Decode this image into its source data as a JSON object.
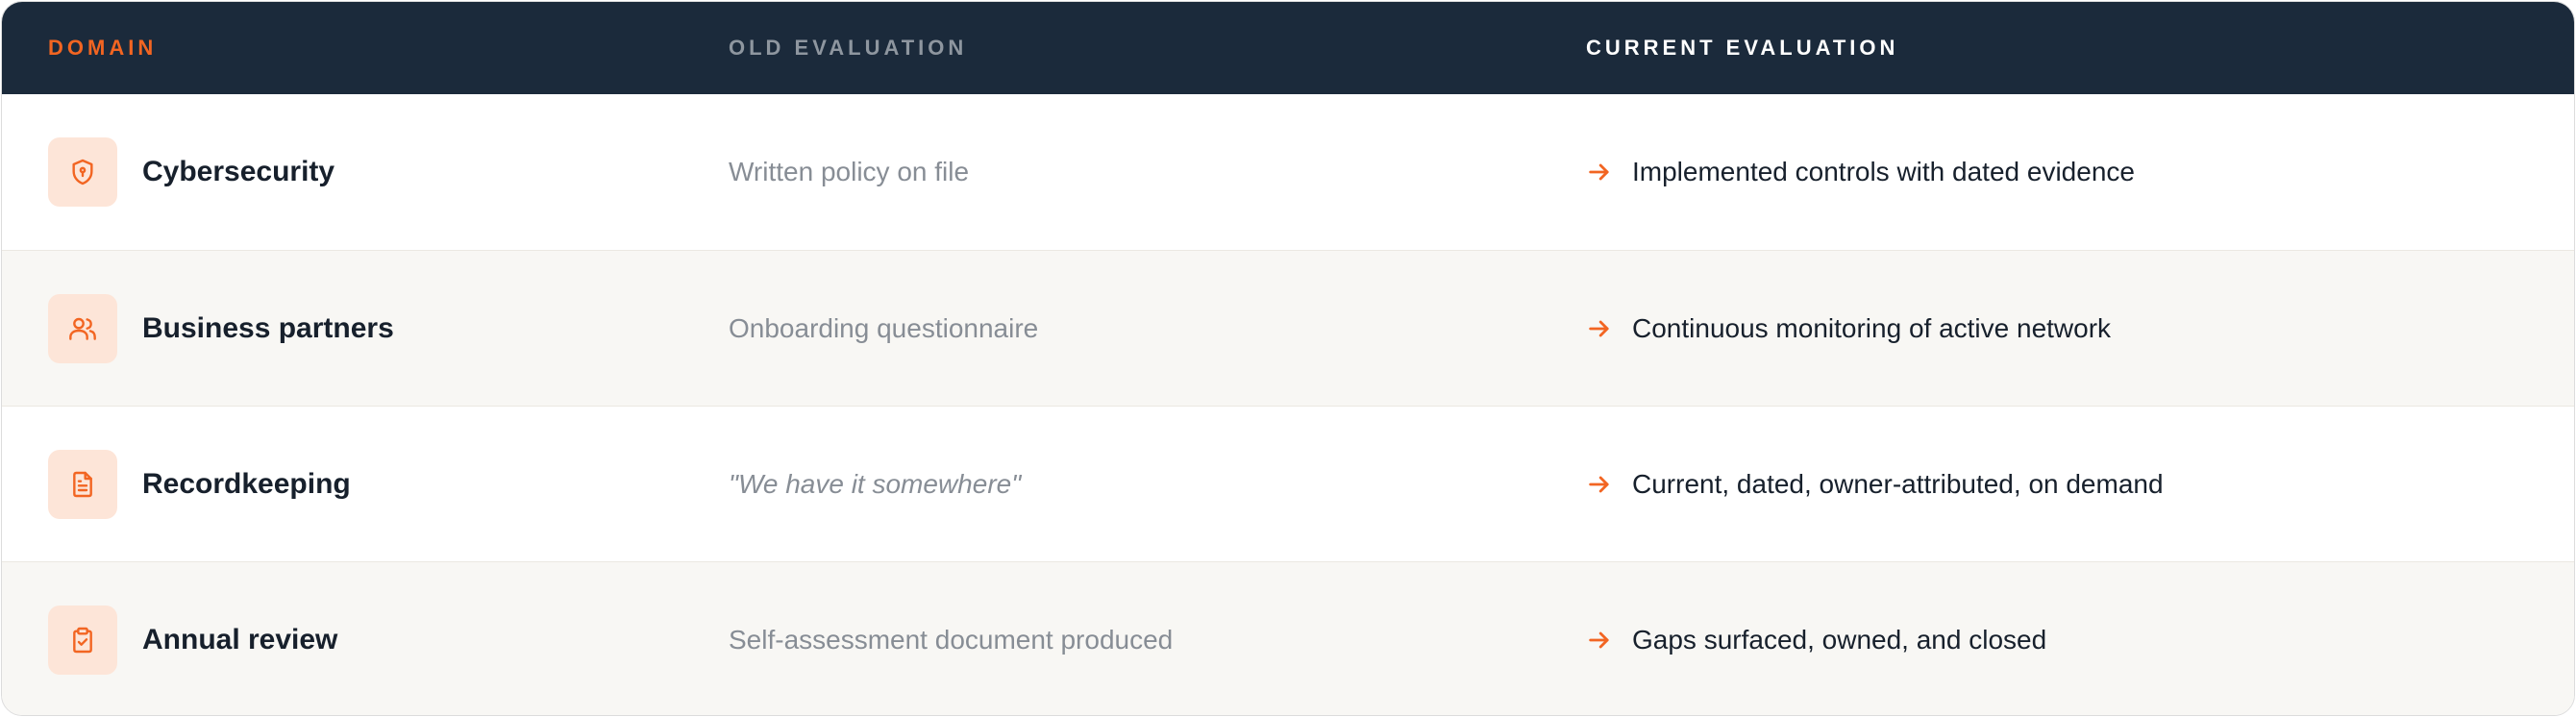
{
  "header": {
    "domain": "DOMAIN",
    "old_evaluation": "OLD EVALUATION",
    "current_evaluation": "CURRENT EVALUATION"
  },
  "colors": {
    "accent": "#f26522",
    "header_bg": "#1b2a3b",
    "icon_bg": "#fde5d8",
    "alt_row_bg": "#f8f7f4"
  },
  "rows": [
    {
      "icon": "shield-icon",
      "domain": "Cybersecurity",
      "old": "Written policy on file",
      "current": "Implemented controls with dated evidence"
    },
    {
      "icon": "users-icon",
      "domain": "Business partners",
      "old": "Onboarding questionnaire",
      "current": "Continuous monitoring of active network"
    },
    {
      "icon": "document-icon",
      "domain": "Recordkeeping",
      "old": "\"We have it somewhere\"",
      "current": "Current, dated, owner-attributed, on demand"
    },
    {
      "icon": "clipboard-check-icon",
      "domain": "Annual review",
      "old": "Self-assessment document produced",
      "current": "Gaps surfaced, owned, and closed"
    }
  ]
}
